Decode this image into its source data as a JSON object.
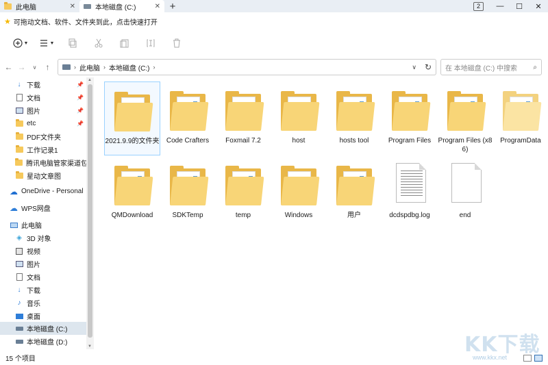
{
  "tabs": [
    {
      "label": "此电脑",
      "active": false,
      "close": "✕"
    },
    {
      "label": "本地磁盘 (C:)",
      "active": true,
      "close": "✕"
    }
  ],
  "tab_add": "+",
  "window": {
    "tab_count": "2",
    "minimize": "—",
    "maximize": "☐",
    "close": "✕"
  },
  "tip": {
    "text": "可拖动文档、软件、文件夹到此，点击快速打开"
  },
  "address": {
    "crumbs": [
      "此电脑",
      "本地磁盘 (C:)"
    ],
    "search_placeholder": "在 本地磁盘 (C:) 中搜索"
  },
  "sidebar": {
    "quick": [
      {
        "label": "下载",
        "icon": "download-arrow-icon",
        "pinned": true
      },
      {
        "label": "文档",
        "icon": "document-icon",
        "pinned": true
      },
      {
        "label": "图片",
        "icon": "picture-icon",
        "pinned": true
      },
      {
        "label": "etc",
        "icon": "folder-icon",
        "pinned": true
      },
      {
        "label": "PDF文件夹",
        "icon": "folder-icon",
        "pinned": false
      },
      {
        "label": "工作记录1",
        "icon": "folder-icon",
        "pinned": false
      },
      {
        "label": "腾讯电脑管家渠道包-老",
        "icon": "folder-icon",
        "pinned": false
      },
      {
        "label": "星动文章图",
        "icon": "folder-icon",
        "pinned": false
      }
    ],
    "cloud": [
      {
        "label": "OneDrive - Personal",
        "icon": "cloud-icon"
      },
      {
        "label": "WPS网盘",
        "icon": "wps-cloud-icon"
      }
    ],
    "pc": {
      "label": "此电脑",
      "icon": "computer-icon"
    },
    "pc_items": [
      {
        "label": "3D 对象",
        "icon": "3d-objects-icon"
      },
      {
        "label": "视频",
        "icon": "video-icon"
      },
      {
        "label": "图片",
        "icon": "picture-icon"
      },
      {
        "label": "文档",
        "icon": "document-icon"
      },
      {
        "label": "下载",
        "icon": "download-arrow-icon"
      },
      {
        "label": "音乐",
        "icon": "music-icon"
      },
      {
        "label": "桌面",
        "icon": "desktop-icon"
      },
      {
        "label": "本地磁盘 (C:)",
        "icon": "drive-icon",
        "selected": true
      },
      {
        "label": "本地磁盘 (D:)",
        "icon": "drive-icon"
      }
    ]
  },
  "files": [
    {
      "name": "2021.9.9的文件夹",
      "type": "folder",
      "selected": true
    },
    {
      "name": "Code Crafters",
      "type": "folder"
    },
    {
      "name": "Foxmail 7.2",
      "type": "folder"
    },
    {
      "name": "host",
      "type": "folder"
    },
    {
      "name": "hosts tool",
      "type": "folder"
    },
    {
      "name": "Program Files",
      "type": "folder"
    },
    {
      "name": "Program Files (x86)",
      "type": "folder"
    },
    {
      "name": "ProgramData",
      "type": "folder",
      "light": true
    },
    {
      "name": "QMDownload",
      "type": "folder"
    },
    {
      "name": "SDKTemp",
      "type": "folder"
    },
    {
      "name": "temp",
      "type": "folder"
    },
    {
      "name": "Windows",
      "type": "folder"
    },
    {
      "name": "用户",
      "type": "folder"
    },
    {
      "name": "dcdspdbg.log",
      "type": "log"
    },
    {
      "name": "end",
      "type": "file"
    }
  ],
  "status": {
    "count": "15 个项目"
  },
  "watermark": {
    "text": "KK下载",
    "url": "www.kkx.net"
  }
}
